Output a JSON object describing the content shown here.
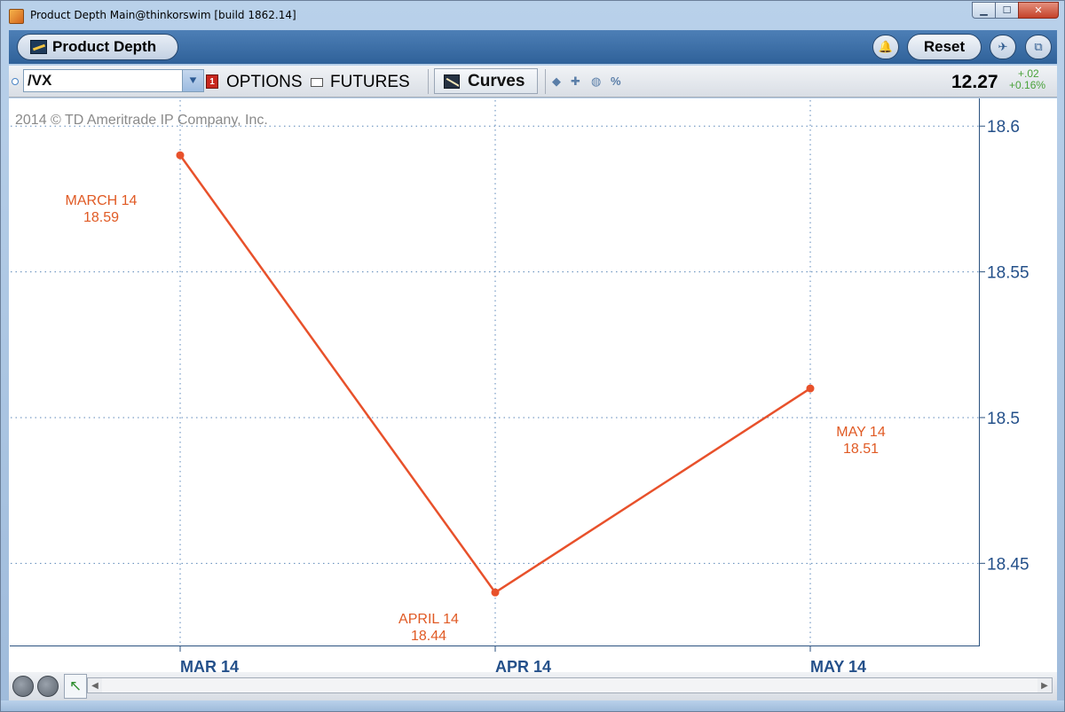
{
  "window": {
    "title": "Product Depth Main@thinkorswim [build 1862.14]",
    "controls": {
      "minimize": "▁",
      "maximize": "☐",
      "close": "✕"
    }
  },
  "header": {
    "product_label": "Product Depth",
    "reset_label": "Reset",
    "icons": [
      "bell-icon",
      "pin-icon",
      "link-icon"
    ]
  },
  "toolbar": {
    "symbol": "/VX",
    "badge": "1",
    "options_label": "OPTIONS",
    "futures_label": "FUTURES",
    "curves_label": "Curves",
    "percent_label": "%",
    "price": "12.27",
    "change_abs": "+.02",
    "change_pct": "+0.16%",
    "colors": {
      "positive": "#4aa23b"
    }
  },
  "chart": {
    "copyright": "2014 © TD Ameritrade IP Company, Inc."
  },
  "chart_data": {
    "type": "line",
    "categories": [
      "MAR 14",
      "APR 14",
      "MAY 14"
    ],
    "series": [
      {
        "values": [
          18.59,
          18.44,
          18.51
        ],
        "color": "#e8512b"
      }
    ],
    "point_labels": [
      {
        "name": "MARCH 14",
        "value": "18.59"
      },
      {
        "name": "APRIL 14",
        "value": "18.44"
      },
      {
        "name": "MAY 14",
        "value": "18.51"
      }
    ],
    "y_ticks": [
      "18.6",
      "18.55",
      "18.5",
      "18.45"
    ],
    "y_tick_values": [
      18.6,
      18.55,
      18.5,
      18.45
    ],
    "ylim": [
      18.4215,
      18.6095
    ],
    "grid": true,
    "axis_color": "#2b527f",
    "label_color": "#e05a24",
    "tick_label_color": "#24508a"
  },
  "bottom": {
    "zoom_in": "zoom-in-icon",
    "zoom_out": "zoom-out-icon",
    "cursor": "pointer-icon"
  }
}
